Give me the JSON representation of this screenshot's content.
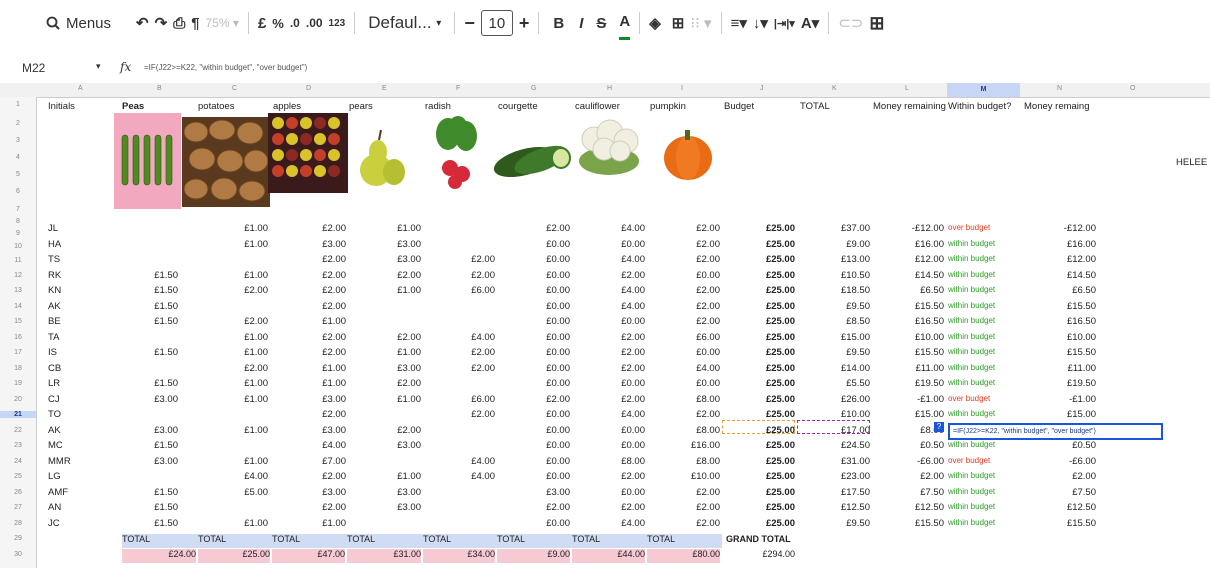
{
  "toolbar": {
    "menus_label": "Menus",
    "zoom": "75%",
    "currency": "£",
    "percent": "%",
    "dec_less": ".0",
    "dec_more": ".00",
    "format_num": "123",
    "font": "Defaul...",
    "font_size": "10",
    "bold": "B",
    "italic": "I",
    "strike": "S",
    "text_color": "A",
    "fill_color_icon": "paint-bucket",
    "align_h": "≡",
    "align_v": "↓",
    "wrap": "|⇥|",
    "rotate": "A"
  },
  "formula_bar": {
    "cell_ref": "M22",
    "fx": "fx",
    "formula": "=IF(J22>=K22, \"within budget\", \"over budget\")"
  },
  "columns": [
    "A",
    "B",
    "C",
    "D",
    "E",
    "F",
    "G",
    "H",
    "I",
    "J",
    "K",
    "L",
    "M",
    "N",
    "O"
  ],
  "headers": {
    "initials": "Initials",
    "peas": "Peas",
    "potatoes": "potatoes",
    "apples": "apples",
    "pears": "pears",
    "radish": "radish",
    "courgette": "courgette",
    "cauliflower": "cauliflower",
    "pumpkin": "pumpkin",
    "budget": "Budget",
    "total": "TOTAL",
    "money_remaining": "Money remaining",
    "within_budget": "Within budget?",
    "money_remaing": "Money remaing"
  },
  "side_label": "HELEE",
  "row_numbers": [
    "1",
    "2",
    "3",
    "4",
    "5",
    "6",
    "7",
    "8",
    "9",
    "10",
    "11",
    "12",
    "13",
    "14",
    "15",
    "16",
    "17",
    "18",
    "19",
    "20",
    "21",
    "22",
    "23",
    "24",
    "25",
    "26",
    "27",
    "28",
    "29",
    "30"
  ],
  "rows": [
    {
      "i": "JL",
      "peas": "",
      "pot": "£1.00",
      "app": "£2.00",
      "pear": "£1.00",
      "rad": "",
      "cour": "£2.00",
      "cau": "£4.00",
      "pum": "£2.00",
      "bud": "£25.00",
      "tot": "£37.00",
      "rem": "-£12.00",
      "wb": "over budget",
      "wbc": "over",
      "mr": "-£12.00"
    },
    {
      "i": "HA",
      "peas": "",
      "pot": "£1.00",
      "app": "£3.00",
      "pear": "£3.00",
      "rad": "",
      "cour": "£0.00",
      "cau": "£0.00",
      "pum": "£2.00",
      "bud": "£25.00",
      "tot": "£9.00",
      "rem": "£16.00",
      "wb": "within budget",
      "wbc": "within",
      "mr": "£16.00"
    },
    {
      "i": "TS",
      "peas": "",
      "pot": "",
      "app": "£2.00",
      "pear": "£3.00",
      "rad": "£2.00",
      "cour": "£0.00",
      "cau": "£4.00",
      "pum": "£2.00",
      "bud": "£25.00",
      "tot": "£13.00",
      "rem": "£12.00",
      "wb": "within budget",
      "wbc": "within",
      "mr": "£12.00"
    },
    {
      "i": "RK",
      "peas": "£1.50",
      "pot": "£1.00",
      "app": "£2.00",
      "pear": "£2.00",
      "rad": "£2.00",
      "cour": "£0.00",
      "cau": "£2.00",
      "pum": "£0.00",
      "bud": "£25.00",
      "tot": "£10.50",
      "rem": "£14.50",
      "wb": "within budget",
      "wbc": "within",
      "mr": "£14.50"
    },
    {
      "i": "KN",
      "peas": "£1.50",
      "pot": "£2.00",
      "app": "£2.00",
      "pear": "£1.00",
      "rad": "£6.00",
      "cour": "£0.00",
      "cau": "£4.00",
      "pum": "£2.00",
      "bud": "£25.00",
      "tot": "£18.50",
      "rem": "£6.50",
      "wb": "within budget",
      "wbc": "within",
      "mr": "£6.50"
    },
    {
      "i": "AK",
      "peas": "£1.50",
      "pot": "",
      "app": "£2.00",
      "pear": "",
      "rad": "",
      "cour": "£0.00",
      "cau": "£4.00",
      "pum": "£2.00",
      "bud": "£25.00",
      "tot": "£9.50",
      "rem": "£15.50",
      "wb": "within budget",
      "wbc": "within",
      "mr": "£15.50"
    },
    {
      "i": "BE",
      "peas": "£1.50",
      "pot": "£2.00",
      "app": "£1.00",
      "pear": "",
      "rad": "",
      "cour": "£0.00",
      "cau": "£0.00",
      "pum": "£2.00",
      "bud": "£25.00",
      "tot": "£8.50",
      "rem": "£16.50",
      "wb": "within budget",
      "wbc": "within",
      "mr": "£16.50"
    },
    {
      "i": "TA",
      "peas": "",
      "pot": "£1.00",
      "app": "£2.00",
      "pear": "£2.00",
      "rad": "£4.00",
      "cour": "£0.00",
      "cau": "£2.00",
      "pum": "£6.00",
      "bud": "£25.00",
      "tot": "£15.00",
      "rem": "£10.00",
      "wb": "within budget",
      "wbc": "within",
      "mr": "£10.00"
    },
    {
      "i": "IS",
      "peas": "£1.50",
      "pot": "£1.00",
      "app": "£2.00",
      "pear": "£1.00",
      "rad": "£2.00",
      "cour": "£0.00",
      "cau": "£2.00",
      "pum": "£0.00",
      "bud": "£25.00",
      "tot": "£9.50",
      "rem": "£15.50",
      "wb": "within budget",
      "wbc": "within",
      "mr": "£15.50"
    },
    {
      "i": "CB",
      "peas": "",
      "pot": "£2.00",
      "app": "£1.00",
      "pear": "£3.00",
      "rad": "£2.00",
      "cour": "£0.00",
      "cau": "£2.00",
      "pum": "£4.00",
      "bud": "£25.00",
      "tot": "£14.00",
      "rem": "£11.00",
      "wb": "within budget",
      "wbc": "within",
      "mr": "£11.00"
    },
    {
      "i": "LR",
      "peas": "£1.50",
      "pot": "£1.00",
      "app": "£1.00",
      "pear": "£2.00",
      "rad": "",
      "cour": "£0.00",
      "cau": "£0.00",
      "pum": "£0.00",
      "bud": "£25.00",
      "tot": "£5.50",
      "rem": "£19.50",
      "wb": "within budget",
      "wbc": "within",
      "mr": "£19.50"
    },
    {
      "i": "CJ",
      "peas": "£3.00",
      "pot": "£1.00",
      "app": "£3.00",
      "pear": "£1.00",
      "rad": "£6.00",
      "cour": "£2.00",
      "cau": "£2.00",
      "pum": "£8.00",
      "bud": "£25.00",
      "tot": "£26.00",
      "rem": "-£1.00",
      "wb": "over budget",
      "wbc": "over",
      "mr": "-£1.00"
    },
    {
      "i": "TO",
      "peas": "",
      "pot": "",
      "app": "£2.00",
      "pear": "",
      "rad": "£2.00",
      "cour": "£0.00",
      "cau": "£4.00",
      "pum": "£2.00",
      "bud": "£25.00",
      "tot": "£10.00",
      "rem": "£15.00",
      "wb": "within budget",
      "wbc": "within",
      "mr": "£15.00"
    },
    {
      "i": "AK",
      "peas": "£3.00",
      "pot": "£1.00",
      "app": "£3.00",
      "pear": "£2.00",
      "rad": "",
      "cour": "£0.00",
      "cau": "£0.00",
      "pum": "£8.00",
      "bud": "£25.00",
      "tot": "£17.00",
      "rem": "£8.00",
      "wb": "=IF(J22>=K22, \"within budget\", \"over budget\")",
      "wbc": "formula",
      "mr": ""
    },
    {
      "i": "MC",
      "peas": "£1.50",
      "pot": "",
      "app": "£4.00",
      "pear": "£3.00",
      "rad": "",
      "cour": "£0.00",
      "cau": "£0.00",
      "pum": "£16.00",
      "bud": "£25.00",
      "tot": "£24.50",
      "rem": "£0.50",
      "wb": "within budget",
      "wbc": "within",
      "mr": "£0.50"
    },
    {
      "i": "MMR",
      "peas": "£3.00",
      "pot": "£1.00",
      "app": "£7.00",
      "pear": "",
      "rad": "£4.00",
      "cour": "£0.00",
      "cau": "£8.00",
      "pum": "£8.00",
      "bud": "£25.00",
      "tot": "£31.00",
      "rem": "-£6.00",
      "wb": "over budget",
      "wbc": "over",
      "mr": "-£6.00"
    },
    {
      "i": "LG",
      "peas": "",
      "pot": "£4.00",
      "app": "£2.00",
      "pear": "£1.00",
      "rad": "£4.00",
      "cour": "£0.00",
      "cau": "£2.00",
      "pum": "£10.00",
      "bud": "£25.00",
      "tot": "£23.00",
      "rem": "£2.00",
      "wb": "within budget",
      "wbc": "within",
      "mr": "£2.00"
    },
    {
      "i": "AMF",
      "peas": "£1.50",
      "pot": "£5.00",
      "app": "£3.00",
      "pear": "£3.00",
      "rad": "",
      "cour": "£3.00",
      "cau": "£0.00",
      "pum": "£2.00",
      "bud": "£25.00",
      "tot": "£17.50",
      "rem": "£7.50",
      "wb": "within budget",
      "wbc": "within",
      "mr": "£7.50"
    },
    {
      "i": "AN",
      "peas": "£1.50",
      "pot": "",
      "app": "£2.00",
      "pear": "£3.00",
      "rad": "",
      "cour": "£2.00",
      "cau": "£2.00",
      "pum": "£2.00",
      "bud": "£25.00",
      "tot": "£12.50",
      "rem": "£12.50",
      "wb": "within budget",
      "wbc": "within",
      "mr": "£12.50"
    },
    {
      "i": "JC",
      "peas": "£1.50",
      "pot": "£1.00",
      "app": "£1.00",
      "pear": "",
      "rad": "",
      "cour": "£0.00",
      "cau": "£4.00",
      "pum": "£2.00",
      "bud": "£25.00",
      "tot": "£9.50",
      "rem": "£15.50",
      "wb": "within budget",
      "wbc": "within",
      "mr": "£15.50"
    }
  ],
  "totals": {
    "label": "TOTAL",
    "values": [
      "£24.00",
      "£25.00",
      "£47.00",
      "£31.00",
      "£34.00",
      "£9.00",
      "£44.00",
      "£80.00"
    ],
    "grand_label": "GRAND TOTAL",
    "grand_value": "£294.00"
  },
  "colors": {
    "over": "#e53b1f",
    "within": "#2f9e27",
    "selection": "#1a56db",
    "total_bg": "#f6c9d3",
    "total_hdr": "#cfdcf4"
  }
}
